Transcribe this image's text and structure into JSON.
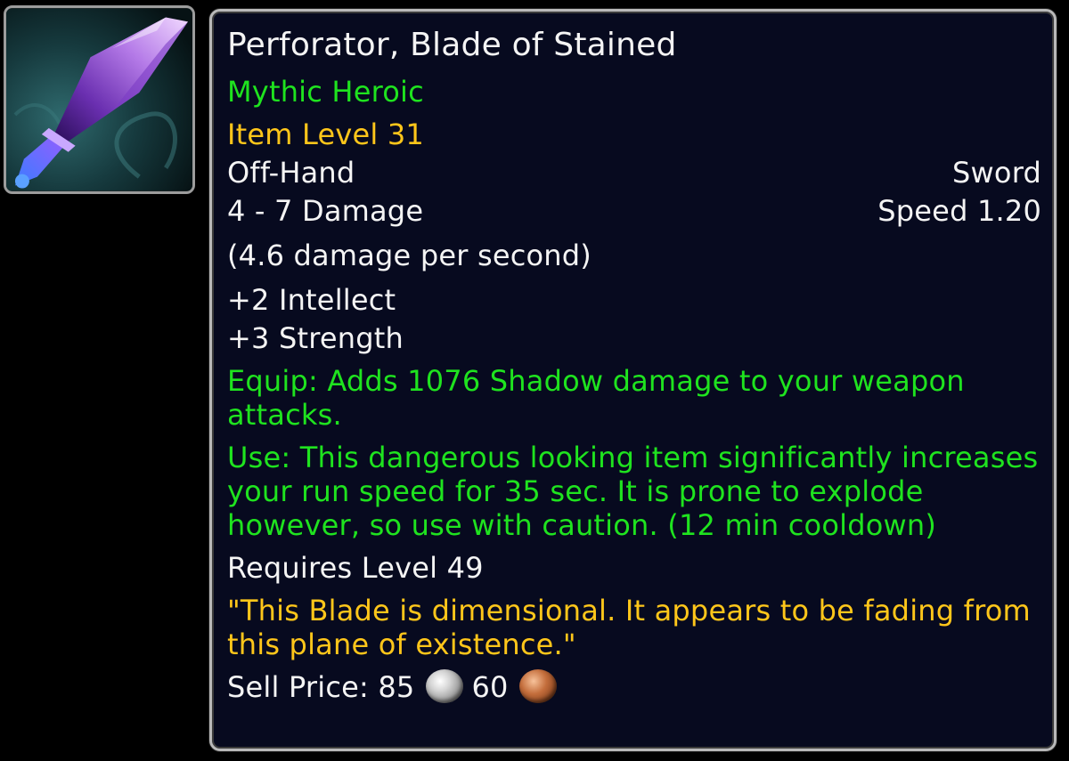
{
  "item": {
    "icon": "purple-crystal-blade-icon",
    "name": "Perforator, Blade of Stained",
    "difficulty": "Mythic Heroic",
    "item_level": "Item Level 31",
    "slot": "Off-Hand",
    "type": "Sword",
    "damage": "4 - 7 Damage",
    "speed": "Speed 1.20",
    "dps": "(4.6 damage per second)",
    "stats": [
      "+2 Intellect",
      "+3 Strength"
    ],
    "equip_effect": "Equip: Adds 1076 Shadow damage to your weapon attacks.",
    "use_effect": "Use: This dangerous looking item significantly increases your run speed for 35 sec. It is prone to explode however, so use with caution. (12 min cooldown)",
    "requires_level": "Requires Level 49",
    "flavor_text": "\"This Blade is dimensional. It appears to be fading from this plane of existence.\"",
    "sell_price": {
      "label": "Sell Price:",
      "silver": "85",
      "copper": "60",
      "silver_icon": "silver-coin-icon",
      "copper_icon": "copper-coin-icon"
    }
  },
  "colors": {
    "name": "#f4f4f4",
    "green_text": "#1fe31f",
    "gold_text": "#ffc61a",
    "background": "#070a1f",
    "border": "#b9b9b9"
  }
}
